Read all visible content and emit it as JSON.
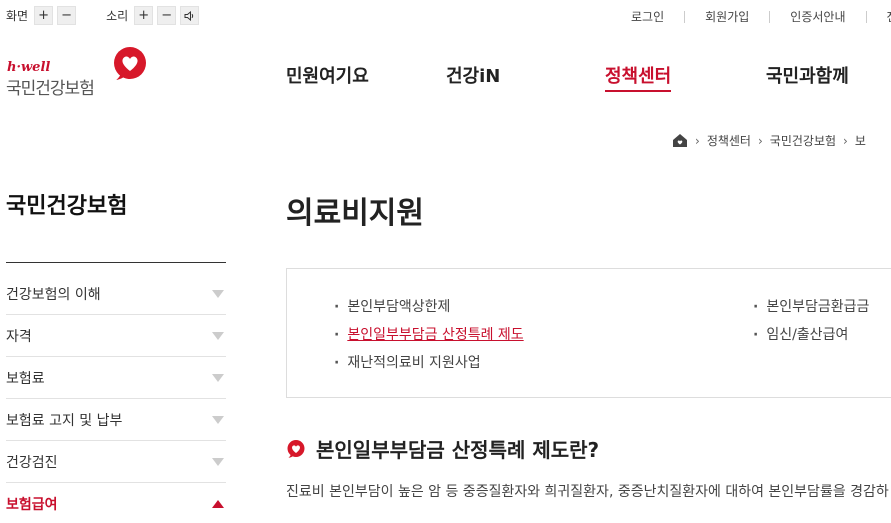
{
  "utility": {
    "screen_label": "화면",
    "sound_label": "소리",
    "plus": "+",
    "minus": "−",
    "links": [
      "로그인",
      "회원가입",
      "인증서안내",
      "전"
    ]
  },
  "logo": {
    "tagline": "h·well",
    "name": "국민건강보험"
  },
  "gnb": {
    "items": [
      "민원여기요",
      "건강iN",
      "정책센터",
      "국민과함께"
    ],
    "active_index": 2
  },
  "breadcrumb": {
    "items": [
      "정책센터",
      "국민건강보험",
      "보"
    ]
  },
  "sidebar": {
    "title": "국민건강보험",
    "items": [
      "건강보험의 이해",
      "자격",
      "보험료",
      "보험료 고지 및 납부",
      "건강검진",
      "보험급여"
    ],
    "active_index": 5
  },
  "main": {
    "title": "의료비지원",
    "links": [
      {
        "label": "본인부담액상한제"
      },
      {
        "label": "본인일부부담금 산정특례 제도"
      },
      {
        "label": "재난적의료비 지원사업"
      },
      {
        "label": "본인부담금환급금"
      },
      {
        "label": "임신/출산급여"
      }
    ],
    "section_title": "본인일부부담금 산정특례 제도란?",
    "section_desc": "진료비 본인부담이 높은 암 등 중증질환자와 희귀질환자, 중증난치질환자에 대하여 본인부담률을 경감하"
  },
  "colors": {
    "accent": "#c8102e",
    "text": "#222222",
    "border": "#dddddd"
  }
}
